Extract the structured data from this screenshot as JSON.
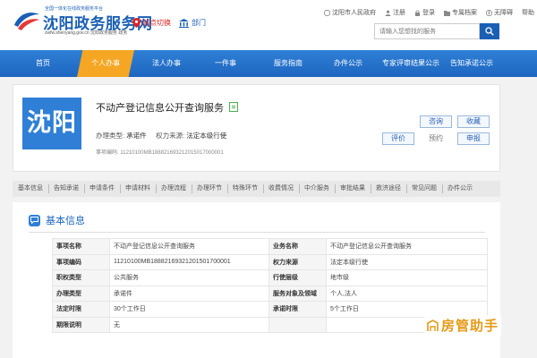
{
  "header": {
    "logo_top": "全国一体化在线政务服务平台",
    "logo_title": "沈阳政务服务网",
    "logo_sub": "zwfw.shenyang.gov.cn 沈阳政务服务 政务",
    "location": "站点切换",
    "dept": "部门",
    "toplinks": [
      "沈阳市人民政府",
      "注册",
      "登录",
      "专属档案",
      "无障碍",
      "帮助"
    ],
    "search_placeholder": "请输入您想找的服务"
  },
  "nav": [
    "首页",
    "个人办事",
    "法人办事",
    "一件事",
    "服务指南",
    "办件公示",
    "专家评审结果公示",
    "告知承诺公示"
  ],
  "service": {
    "city": "沈阳",
    "title": "不动产登记信息公开查询服务",
    "type_label": "办理类型:",
    "type_value": "承诺件",
    "source_label": "权力来源:",
    "source_value": "法定本级行使",
    "code_label": "事项编码:",
    "code_value": "11210100MB188821693212015017000001",
    "buttons": {
      "consult": "咨询",
      "favorite": "收藏",
      "evaluate": "评价",
      "reserve": "预约",
      "apply": "申报"
    }
  },
  "tabs": [
    "基本信息",
    "告知承诺",
    "申请条件",
    "申请材料",
    "办理流程",
    "办理环节",
    "特殊环节",
    "收费情况",
    "中介服务",
    "审批结果",
    "救济途径",
    "常见问题",
    "办件公示"
  ],
  "info": {
    "title": "基本信息",
    "rows": [
      {
        "k1": "事项名称",
        "v1": "不动产登记信息公开查询服务",
        "k2": "业务名称",
        "v2": "不动产登记信息公开查询服务"
      },
      {
        "k1": "事项编码",
        "v1": "11210100MB18882169321201501700001",
        "k2": "权力来源",
        "v2": "法定本级行使"
      },
      {
        "k1": "职权类型",
        "v1": "公共服务",
        "k2": "行使层级",
        "v2": "地市级"
      },
      {
        "k1": "办理类型",
        "v1": "承诺件",
        "k2": "服务对象及领域",
        "v2": "个人,法人"
      },
      {
        "k1": "法定时限",
        "v1": "30个工作日",
        "k2": "承诺时限",
        "v2": "5个工作日"
      },
      {
        "k1": "期限说明",
        "v1": "无",
        "k2": "",
        "v2": ""
      }
    ]
  },
  "watermark": "房管助手",
  "colors": {
    "brand": "#1a5fb4",
    "accent": "#f5a623",
    "nav": "#2f7fd6"
  }
}
